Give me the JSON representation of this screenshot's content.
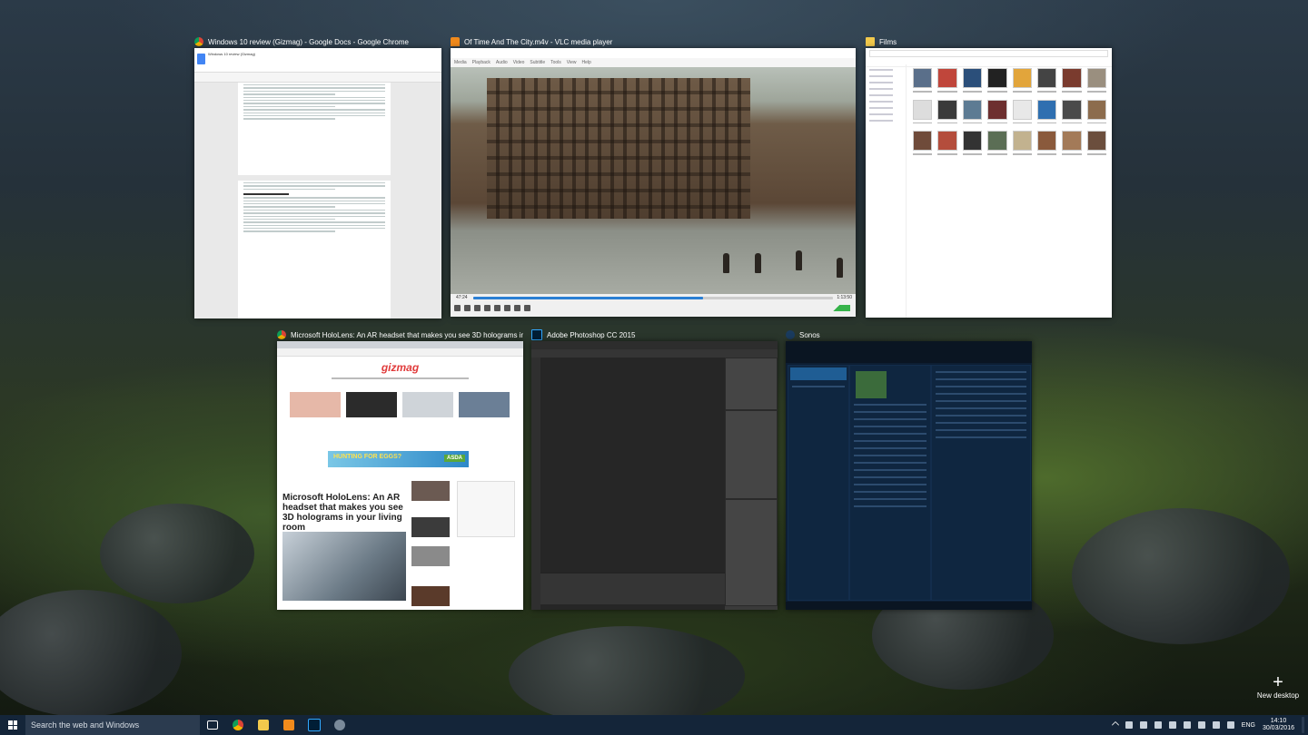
{
  "windows": {
    "docs": {
      "title": "Windows 10 review (Gizmag) - Google Docs - Google Chrome",
      "doc_title": "Windows 10 review (Gizmag)"
    },
    "vlc": {
      "title": "Of Time And The City.m4v - VLC media player",
      "menu": [
        "Media",
        "Playback",
        "Audio",
        "Video",
        "Subtitle",
        "Tools",
        "View",
        "Help"
      ],
      "elapsed": "47:24",
      "total": "1:13:50",
      "progress": 0.64
    },
    "explorer": {
      "title": "Films"
    },
    "gizmag": {
      "title": "Microsoft HoloLens: An AR headset that makes you see 3D holograms in your li...",
      "logo": "gizmag",
      "headline": "Microsoft HoloLens: An AR headset that makes you see 3D holograms in your living room",
      "ad_text": "HUNTING FOR EGGS?",
      "ad_brand": "ASDA"
    },
    "photoshop": {
      "title": "Adobe Photoshop CC 2015"
    },
    "sonos": {
      "title": "Sonos"
    }
  },
  "new_desktop": {
    "label": "New desktop"
  },
  "taskbar": {
    "search_placeholder": "Search the web and Windows",
    "language": "ENG",
    "time": "14:10",
    "date": "30/03/2016"
  },
  "colors": {
    "taskbar": "#142539",
    "chrome_red": "#db4437",
    "vlc_orange": "#f08a1c",
    "photoshop_blue": "#31a8ff",
    "sonos_dark": "#0d1e33"
  },
  "icons": [
    "task-view-icon",
    "chrome-icon",
    "file-explorer-icon",
    "vlc-icon",
    "photoshop-icon",
    "sonos-icon"
  ]
}
